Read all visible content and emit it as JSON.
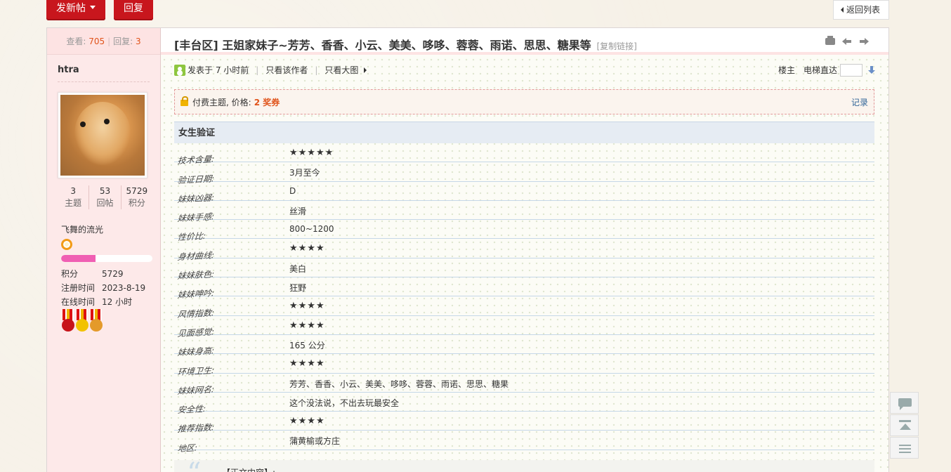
{
  "toolbar": {
    "new_post": "发新帖",
    "reply": "回复",
    "back": "返回列表"
  },
  "sidebar": {
    "views_label": "查看:",
    "views": "705",
    "replies_label": "回复:",
    "replies": "3",
    "author": "htra",
    "stats": [
      {
        "value": "3",
        "label": "主题"
      },
      {
        "value": "53",
        "label": "回帖"
      },
      {
        "value": "5729",
        "label": "积分"
      }
    ],
    "user_title": "飞舞的流光",
    "level_progress": 0.38,
    "info": [
      {
        "key": "积分",
        "value": "5729"
      },
      {
        "key": "注册时间",
        "value": "2023-8-19"
      },
      {
        "key": "在线时间",
        "value": "12 小时"
      }
    ]
  },
  "thread": {
    "title": "[丰台区] 王姐家妹子~芳芳、香香、小云、美美、哆哆、蓉蓉、雨诺、思思、糖果等",
    "copy_link": "[复制链接]",
    "posted": "发表于 7 小时前",
    "only_author": "只看该作者",
    "only_image": "只看大图",
    "floor": "楼主",
    "jump_label": "电梯直达",
    "paid_label": "付费主题, 价格:",
    "paid_price": "2 奖券",
    "paid_record": "记录",
    "verify_title": "女生验证",
    "verify_rows": [
      {
        "key": "技术含量:",
        "value": "★★★★★"
      },
      {
        "key": "验证日期:",
        "value": "3月至今"
      },
      {
        "key": "妹妹凶器:",
        "value": "D"
      },
      {
        "key": "妹妹手感:",
        "value": "丝滑"
      },
      {
        "key": "性价比:",
        "value": "800~1200"
      },
      {
        "key": "身材曲线:",
        "value": "★★★★"
      },
      {
        "key": "妹妹肤色:",
        "value": "美白"
      },
      {
        "key": "妹妹呻吟:",
        "value": "狂野"
      },
      {
        "key": "风情指数:",
        "value": "★★★★"
      },
      {
        "key": "见面感觉:",
        "value": "★★★★"
      },
      {
        "key": "妹妹身高:",
        "value": "165 公分"
      },
      {
        "key": "环境卫生:",
        "value": "★★★★"
      },
      {
        "key": "妹妹网名:",
        "value": "芳芳、香香、小云、美美、哆哆、蓉蓉、雨诺、思思、糖果"
      },
      {
        "key": "安全性:",
        "value": "这个没法说，不出去玩最安全"
      },
      {
        "key": "推荐指数:",
        "value": "★★★★"
      },
      {
        "key": "地区:",
        "value": "蒲黄榆或方庄"
      }
    ],
    "quote_text": "【正文内容】:"
  },
  "colors": {
    "accent_red": "#c8161d",
    "highlight": "#e0531a",
    "sidebar_bg": "#fde9e9",
    "level_fill": "#f05fb3"
  }
}
